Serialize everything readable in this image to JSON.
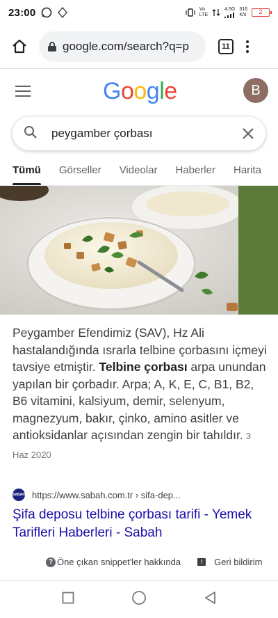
{
  "status_bar": {
    "time": "23:00",
    "net_label_top": "Vo",
    "net_label_bottom": "LTE",
    "signal_label": "4.5G",
    "speed_top": "316",
    "speed_bottom": "K/s",
    "battery": "2"
  },
  "browser": {
    "url": "google.com/search?q=p",
    "tab_count": "11"
  },
  "header": {
    "logo_letters": [
      "G",
      "o",
      "o",
      "g",
      "l",
      "e"
    ],
    "avatar_initial": "B"
  },
  "search": {
    "query": "peygamber çorbası"
  },
  "tabs": [
    {
      "label": "Tümü",
      "active": true
    },
    {
      "label": "Görseller",
      "active": false
    },
    {
      "label": "Videolar",
      "active": false
    },
    {
      "label": "Haberler",
      "active": false
    },
    {
      "label": "Harita",
      "active": false
    }
  ],
  "snippet": {
    "text_before_bold": "Peygamber Efendimiz (SAV), Hz Ali hastalandığında ısrarla telbine çorbasını içmeyi tavsiye etmiştir. ",
    "bold": "Telbine çorbası",
    "text_after_bold": " arpa unundan yapılan bir çorbadır. Arpa; A, K, E, C, B1, B2, B6 vitamini, kalsiyum, demir, selenyum, magnezyum, bakır, çinko, amino asitler ve antioksidanlar açısından zengin bir tahıldır.",
    "date": "3 Haz 2020"
  },
  "result": {
    "url": "https://www.sabah.com.tr › sifa-dep...",
    "title": "Şifa deposu telbine çorbası tarifi - Yemek Tarifleri Haberleri - Sabah",
    "favicon_text": "SABAH"
  },
  "feedback": {
    "about": "Öne çıkan snippet'ler hakkında",
    "report": "Geri bildirim"
  },
  "colors": {
    "link": "#1a0dab",
    "accent_green": "#5d7a3a",
    "battery": "#e53935"
  }
}
